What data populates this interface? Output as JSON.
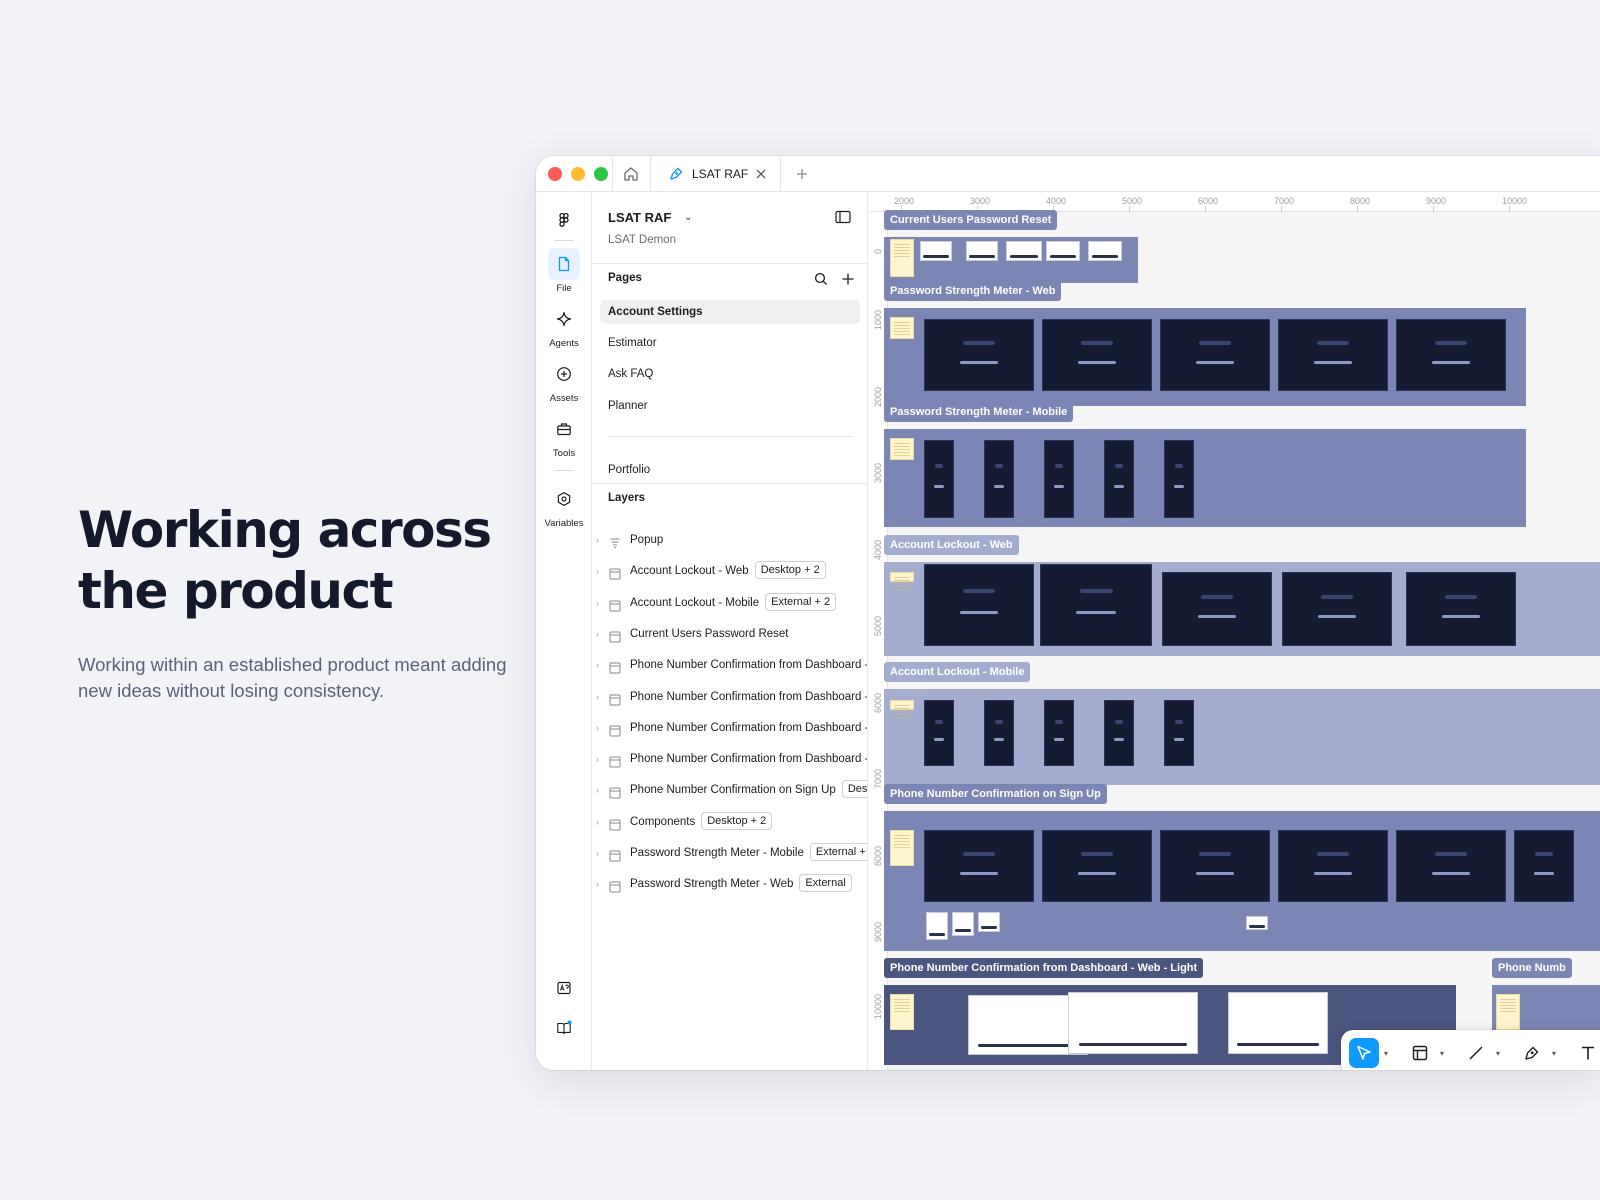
{
  "hero": {
    "title": "Working across the product",
    "subtitle": "Working within an established product meant adding new ideas without losing consistency."
  },
  "window": {
    "tab_label": "LSAT RAF",
    "accent": "#0d99ff"
  },
  "rail": {
    "file": "File",
    "agents": "Agents",
    "assets": "Assets",
    "tools": "Tools",
    "variables": "Variables"
  },
  "panel": {
    "file_name": "LSAT RAF",
    "team_name": "LSAT Demon",
    "pages_title": "Pages",
    "pages": [
      "Account Settings",
      "Estimator",
      "Ask FAQ",
      "Planner",
      "Portfolio"
    ],
    "selected_page": "Account Settings",
    "layers_title": "Layers",
    "layers": [
      {
        "name": "Popup",
        "tag": ""
      },
      {
        "name": "Account Lockout - Web",
        "tag": "Desktop + 2"
      },
      {
        "name": "Account Lockout - Mobile",
        "tag": "External + 2"
      },
      {
        "name": "Current Users Password Reset",
        "tag": ""
      },
      {
        "name": "Phone Number Confirmation from Dashboard -",
        "tag": ""
      },
      {
        "name": "Phone Number Confirmation from Dashboard -",
        "tag": ""
      },
      {
        "name": "Phone Number Confirmation from Dashboard -",
        "tag": ""
      },
      {
        "name": "Phone Number Confirmation from Dashboard -",
        "tag": ""
      },
      {
        "name": "Phone Number Confirmation on Sign Up",
        "tag": "Des"
      },
      {
        "name": "Components",
        "tag": "Desktop + 2"
      },
      {
        "name": "Password Strength Meter - Mobile",
        "tag": "External +"
      },
      {
        "name": "Password Strength Meter - Web",
        "tag": "External"
      }
    ]
  },
  "canvas": {
    "ruler_x": [
      "2000",
      "3000",
      "4000",
      "5000",
      "6000",
      "7000",
      "8000",
      "9000",
      "10000"
    ],
    "ruler_y": [
      "0",
      "1000",
      "2000",
      "3000",
      "4000",
      "5000",
      "6000",
      "7000",
      "8000",
      "9000",
      "10000"
    ],
    "sections": [
      {
        "label": "Current Users Password Reset",
        "color": "#7b86b5"
      },
      {
        "label": "Password Strength Meter - Web",
        "color": "#7b86b5"
      },
      {
        "label": "Password Strength Meter - Mobile",
        "color": "#7b86b5"
      },
      {
        "label": "Account Lockout - Web",
        "color": "#a4add0"
      },
      {
        "label": "Account Lockout - Mobile",
        "color": "#a4add0"
      },
      {
        "label": "Phone Number Confirmation on Sign Up",
        "color": "#7b86b5"
      },
      {
        "label": "Phone Number Confirmation from Dashboard - Web - Light",
        "color": "#4b5680"
      },
      {
        "label": "Phone Numb",
        "color": "#7b86b5"
      }
    ]
  },
  "toolbar": {
    "tools": [
      "move-tool",
      "frame-tool",
      "line-tool",
      "pen-tool",
      "text-tool",
      "comment-tool",
      "actions-tool",
      "draw-mode",
      "design-mode",
      "prototype-mode",
      "dev-mode"
    ]
  }
}
